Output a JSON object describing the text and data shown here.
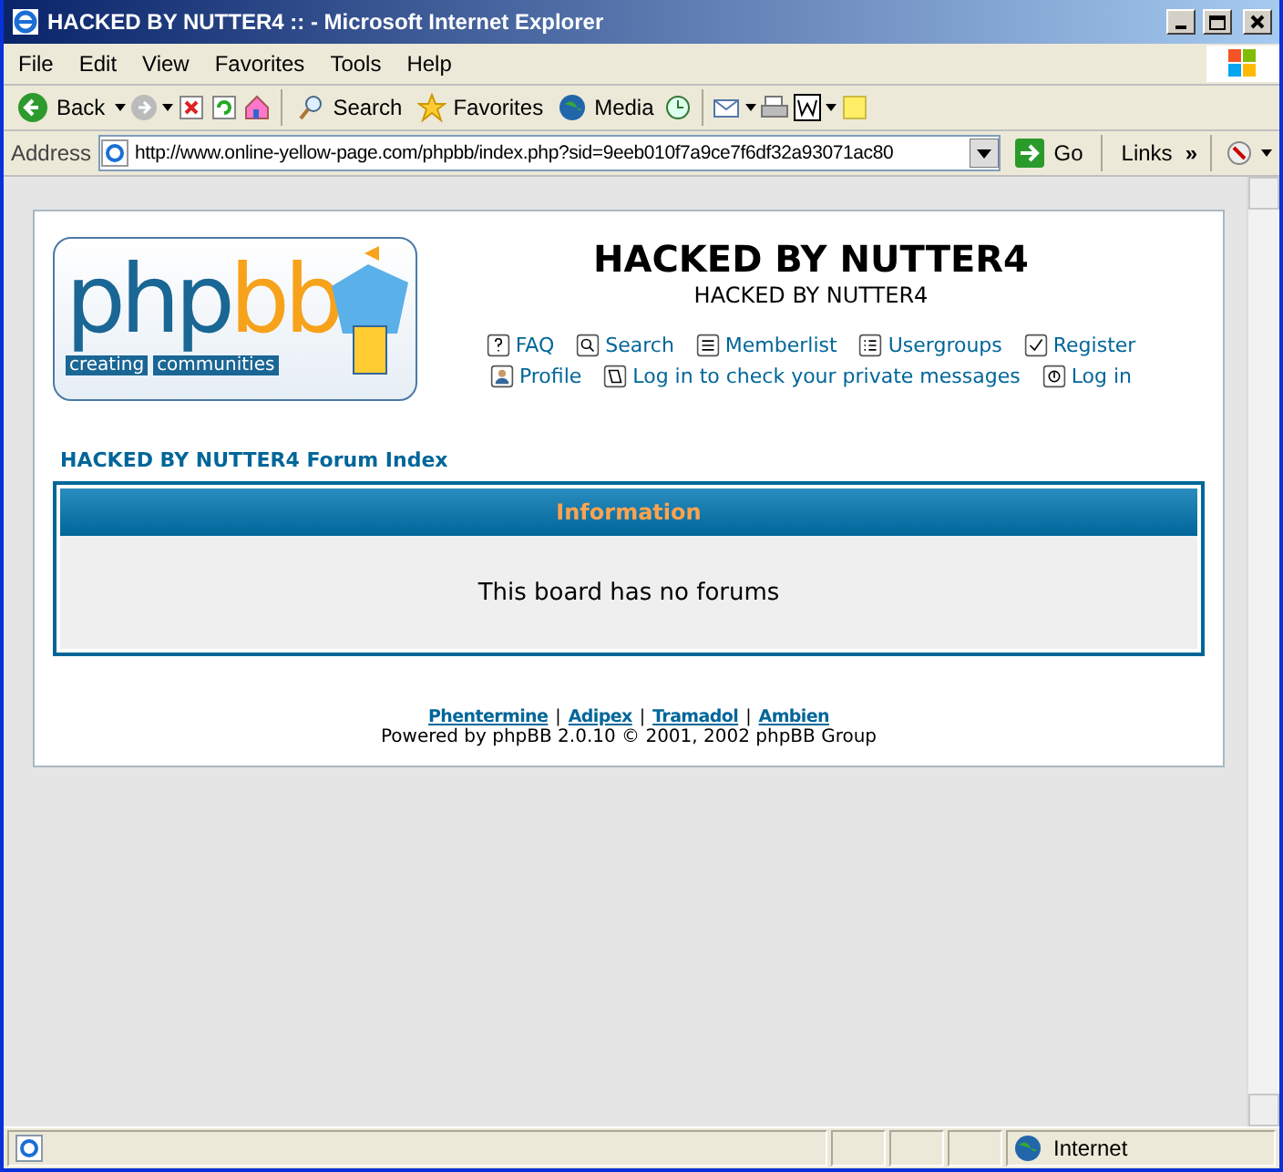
{
  "window": {
    "title": "HACKED BY NUTTER4 :: - Microsoft Internet Explorer"
  },
  "menu": [
    "File",
    "Edit",
    "View",
    "Favorites",
    "Tools",
    "Help"
  ],
  "toolbar": {
    "back": "Back",
    "search": "Search",
    "favorites": "Favorites",
    "media": "Media"
  },
  "address_bar": {
    "label": "Address",
    "url": "http://www.online-yellow-page.com/phpbb/index.php?sid=9eeb010f7a9ce7f6df32a93071ac80",
    "go": "Go",
    "links": "Links",
    "chevron": "»"
  },
  "page": {
    "logo": {
      "word_1": "php",
      "word_2": "bb",
      "tagline_1": "creating",
      "tagline_2": "communities"
    },
    "site_title": "HACKED BY NUTTER4",
    "site_description": "HACKED BY NUTTER4",
    "nav_rows": [
      [
        "FAQ",
        "Search",
        "Memberlist",
        "Usergroups",
        "Register"
      ],
      [
        "Profile",
        "Log in to check your private messages",
        "Log in"
      ]
    ],
    "breadcrumb": "HACKED BY NUTTER4 Forum Index",
    "info_header": "Information",
    "info_message": "This board has no forums",
    "footer_links": [
      "Phentermine",
      "Adipex",
      "Tramadol",
      "Ambien"
    ],
    "separator": "|",
    "powered_by": "Powered by phpBB 2.0.10 © 2001, 2002 phpBB Group"
  },
  "status_bar": {
    "zone": "Internet"
  }
}
